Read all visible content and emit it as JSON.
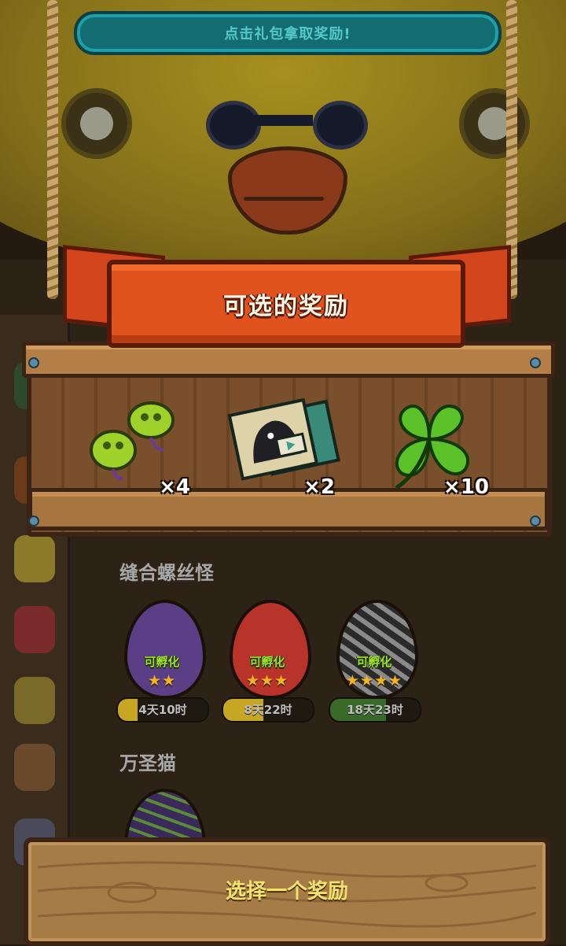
{
  "top_banner": {
    "text": "点击礼包拿取奖励!"
  },
  "rewards_panel": {
    "title": "可选的奖励",
    "items": [
      {
        "icon": "green-pea-pods-icon",
        "quantity": "×4"
      },
      {
        "icon": "blueprint-map-icon",
        "quantity": "×2"
      },
      {
        "icon": "four-leaf-clover-icon",
        "quantity": "×10"
      }
    ]
  },
  "sections": [
    {
      "title": "缝合螺丝怪",
      "eggs": [
        {
          "icon": "purple-swirl-egg-icon",
          "status": "可孵化",
          "stars": "★★",
          "timer": "4天10时",
          "progress": 0.22,
          "color": "#5b3f86"
        },
        {
          "icon": "fire-egg-icon",
          "status": "可孵化",
          "stars": "★★★",
          "timer": "8天22时",
          "progress": 0.45,
          "color": "#b8332a"
        },
        {
          "icon": "zebra-egg-icon",
          "status": "可孵化",
          "stars": "★★★★",
          "timer": "18天23时",
          "progress": 0.62,
          "color": "#555555"
        }
      ]
    },
    {
      "title": "万圣猫",
      "eggs": [
        {
          "icon": "halloween-egg-icon",
          "color": "#4a3a6a"
        }
      ]
    }
  ],
  "bottom_button": {
    "label": "选择一个奖励"
  },
  "colors": {
    "accent": "#e0531f",
    "button_text": "#f3e36a",
    "hatch_text": "#9fe02a",
    "timer_fill": "#c6a622"
  }
}
